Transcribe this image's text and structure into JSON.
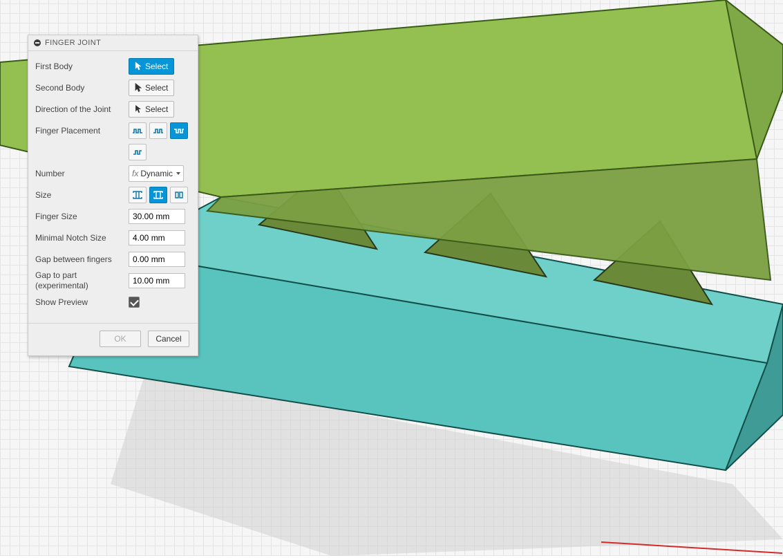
{
  "dialog": {
    "title": "FINGER JOINT",
    "rows": {
      "first_body": {
        "label": "First Body",
        "select_text": "Select"
      },
      "second_body": {
        "label": "Second Body",
        "select_text": "Select"
      },
      "direction": {
        "label": "Direction of the Joint",
        "select_text": "Select"
      },
      "finger_placement": {
        "label": "Finger Placement"
      },
      "number": {
        "label": "Number",
        "combo_text": "Dynamic"
      },
      "size": {
        "label": "Size"
      },
      "finger_size": {
        "label": "Finger Size",
        "value": "30.00 mm"
      },
      "minimal_notch": {
        "label": "Minimal Notch Size",
        "value": "4.00 mm"
      },
      "gap_fingers": {
        "label": "Gap between fingers",
        "value": "0.00 mm"
      },
      "gap_part": {
        "label": "Gap to part (experimental)",
        "value": "10.00 mm"
      },
      "preview": {
        "label": "Show Preview",
        "checked": true
      }
    },
    "footer": {
      "ok": "OK",
      "cancel": "Cancel"
    }
  },
  "colors": {
    "accent": "#0696d7",
    "body_top": "#94c051",
    "body_top_side": "#7fa846",
    "body_top_dark": "#6a8a3a",
    "body_bottom": "#59c3bd",
    "body_bottom_front": "#4aaea8",
    "body_bottom_side": "#3f9b95",
    "shadow": "#c9c9c9"
  }
}
